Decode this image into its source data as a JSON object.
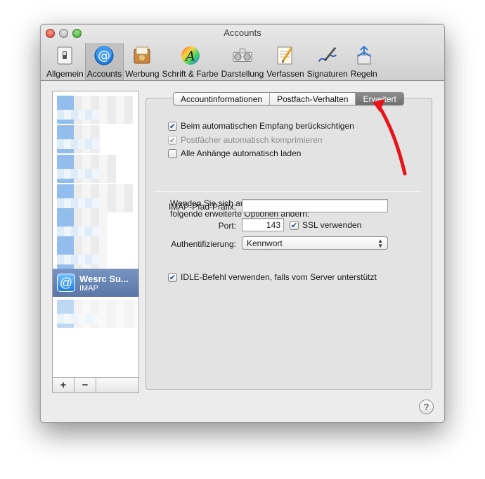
{
  "window": {
    "title": "Accounts"
  },
  "toolbar": {
    "items": [
      {
        "label": "Allgemein",
        "icon": "switch-icon"
      },
      {
        "label": "Accounts",
        "icon": "at-icon",
        "active": true
      },
      {
        "label": "Werbung",
        "icon": "junk-mail-icon"
      },
      {
        "label": "Schrift & Farbe",
        "icon": "font-color-icon"
      },
      {
        "label": "Darstellung",
        "icon": "viewing-icon"
      },
      {
        "label": "Verfassen",
        "icon": "compose-icon"
      },
      {
        "label": "Signaturen",
        "icon": "signature-icon"
      },
      {
        "label": "Regeln",
        "icon": "rules-icon"
      }
    ]
  },
  "sidebar": {
    "selected_account": {
      "name": "Wesrc Su...",
      "type": "IMAP"
    },
    "add_label": "+",
    "remove_label": "−"
  },
  "tabs": {
    "items": [
      "Accountinformationen",
      "Postfach-Verhalten",
      "Erweitert"
    ],
    "active": "Erweitert"
  },
  "options": {
    "auto_fetch": {
      "label": "Beim automatischen Empfang berücksichtigen",
      "checked": true
    },
    "auto_compact": {
      "label": "Postfächer automatisch komprimieren",
      "checked": true,
      "disabled": true
    },
    "download_attachments": {
      "label": "Alle Anhänge automatisch laden",
      "checked": false
    }
  },
  "advanced": {
    "notice": "Wenden Sie sich an Ihren Systemadministrator, bevor Sie folgende erweiterte Optionen ändern:",
    "imap_prefix_label": "IMAP-Pfad-Präfix:",
    "imap_prefix_value": "",
    "port_label": "Port:",
    "port_value": "143",
    "ssl_label": "SSL verwenden",
    "ssl_checked": true,
    "auth_label": "Authentifizierung:",
    "auth_value": "Kennwort",
    "idle_label": "IDLE-Befehl verwenden, falls vom Server unterstützt",
    "idle_checked": true
  },
  "help": {
    "label": "?"
  },
  "colors": {
    "arrow": "#e8131b",
    "selection": "#6a86b7"
  }
}
